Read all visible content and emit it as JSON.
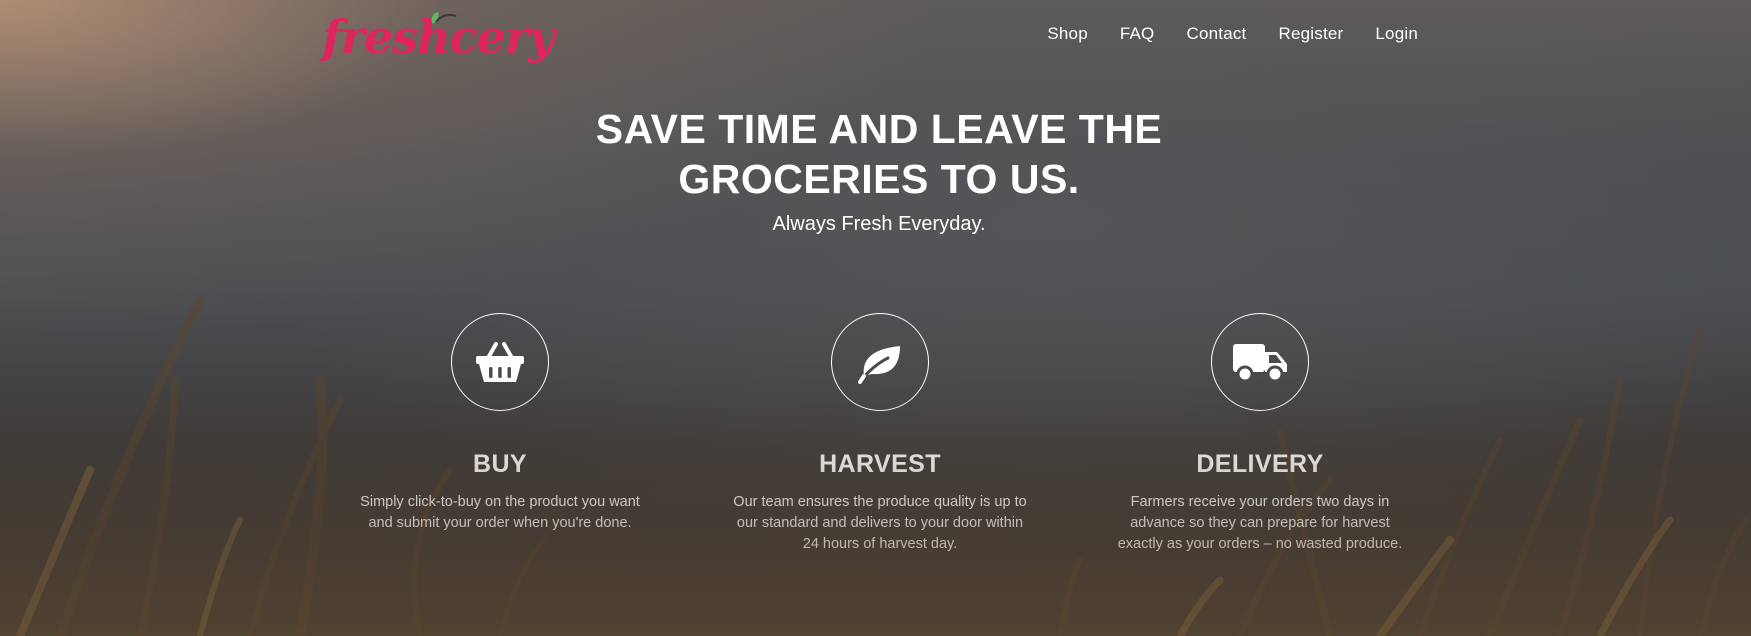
{
  "brand": {
    "name": "freshcery",
    "logo_color": "#e0245e",
    "leaf_color": "#5cb85c"
  },
  "nav": {
    "items": [
      {
        "label": "Shop"
      },
      {
        "label": "FAQ"
      },
      {
        "label": "Contact"
      },
      {
        "label": "Register"
      },
      {
        "label": "Login"
      }
    ]
  },
  "hero": {
    "headline_line1": "SAVE TIME AND LEAVE THE",
    "headline_line2": "GROCERIES TO US.",
    "tagline": "Always Fresh Everyday."
  },
  "features": [
    {
      "icon": "basket-icon",
      "title": "BUY",
      "description": "Simply click-to-buy on the product you want and submit your order when you're done."
    },
    {
      "icon": "leaf-icon",
      "title": "HARVEST",
      "description": "Our team ensures the produce quality is up to our standard and delivers to your door within 24 hours of harvest day."
    },
    {
      "icon": "truck-icon",
      "title": "DELIVERY",
      "description": "Farmers receive your orders two days in advance so they can prepare for harvest exactly as your orders – no wasted produce."
    }
  ]
}
